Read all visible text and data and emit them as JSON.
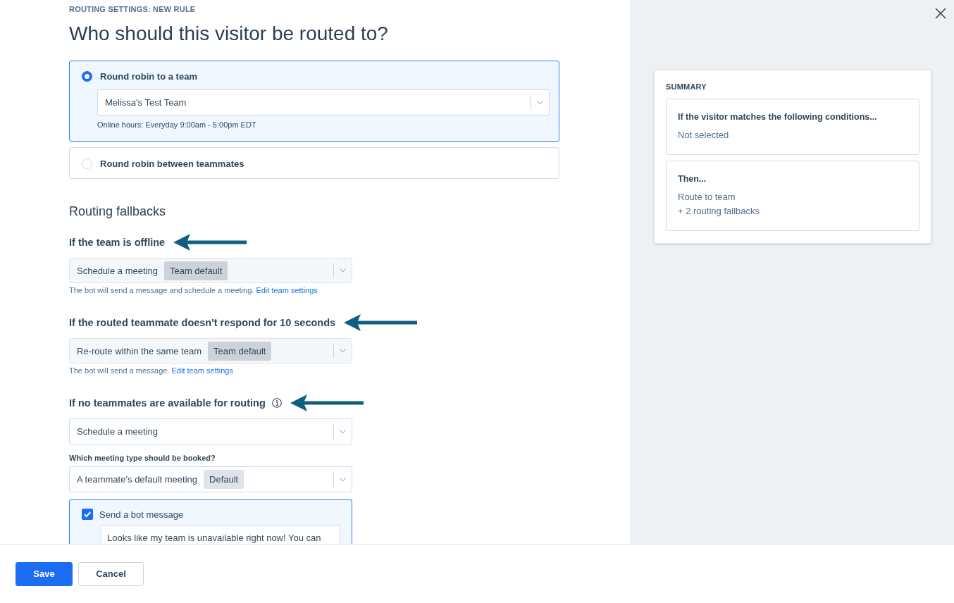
{
  "header": {
    "eyebrow": "ROUTING SETTINGS: NEW RULE",
    "title": "Who should this visitor be routed to?"
  },
  "routing_options": [
    {
      "label": "Round robin to a team",
      "selected": true,
      "select": {
        "value": "Melissa's Test Team"
      },
      "note": "Online hours: Everyday 9:00am - 5:00pm EDT"
    },
    {
      "label": "Round robin between teammates",
      "selected": false
    }
  ],
  "fallbacks": {
    "title": "Routing fallbacks",
    "sections": [
      {
        "heading": "If the team is offline",
        "arrow": true,
        "select": {
          "value": "Schedule a meeting",
          "tag": "Team default",
          "disabled": true
        },
        "help": "The bot will send a message and schedule a meeting.",
        "link": "Edit team settings"
      },
      {
        "heading": "If the routed teammate doesn't respond for 10 seconds",
        "arrow": true,
        "select": {
          "value": "Re-route within the same team",
          "tag": "Team default",
          "disabled": true
        },
        "help": "The bot will send a message.",
        "link": "Edit team settings"
      },
      {
        "heading": "If no teammates are available for routing",
        "info": true,
        "arrow": true,
        "select": {
          "value": "Schedule a meeting",
          "disabled": false
        },
        "meeting_type": {
          "label": "Which meeting type should be booked?",
          "select": {
            "value": "A teammate’s default meeting",
            "tag": "Default",
            "disabled": false
          }
        },
        "bot_message": {
          "label": "Send a bot message",
          "checked": true,
          "value": "Looks like my team is unavailable right now! You can"
        }
      }
    ]
  },
  "summary": {
    "title": "SUMMARY",
    "blocks": [
      {
        "heading": "If the visitor matches the following conditions...",
        "lines": [
          "Not selected"
        ]
      },
      {
        "heading": "Then...",
        "lines": [
          "Route to team",
          "+ 2 routing fallbacks"
        ]
      }
    ]
  },
  "footer": {
    "buttons": [
      {
        "label": "Save",
        "kind": "primary"
      },
      {
        "label": "Cancel",
        "kind": "secondary"
      }
    ]
  }
}
